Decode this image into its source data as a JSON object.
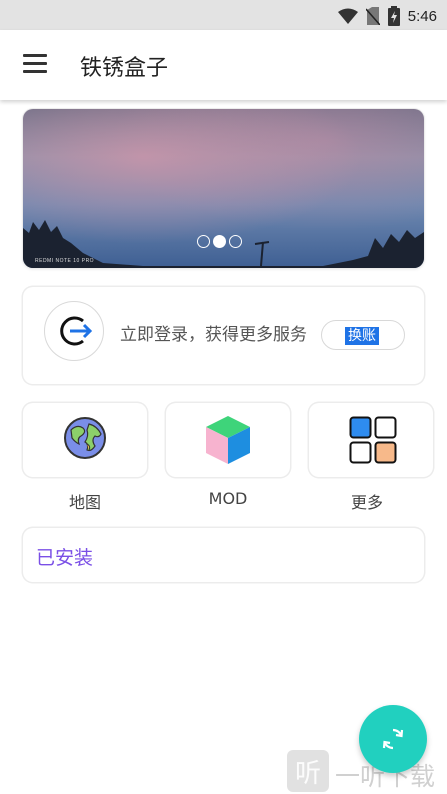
{
  "status_bar": {
    "time": "5:46"
  },
  "app_bar": {
    "title": "铁锈盒子"
  },
  "banner": {
    "watermark": "REDMI NOTE 10 PRO",
    "active_slide": 2,
    "slide_count": 3
  },
  "login": {
    "prompt": "立即登录，获得更多服务",
    "switch_label": "换账"
  },
  "tiles": [
    {
      "label": "地图",
      "icon": "globe-icon"
    },
    {
      "label": "MOD",
      "icon": "cube-icon"
    },
    {
      "label": "更多",
      "icon": "grid-icon"
    }
  ],
  "installed": {
    "label": "已安装"
  },
  "watermark": {
    "glyph": "听",
    "text": "一听下载"
  },
  "colors": {
    "accent": "#21d0bf",
    "installed_text": "#7a4fe6",
    "switch_badge": "#1f73e6"
  }
}
